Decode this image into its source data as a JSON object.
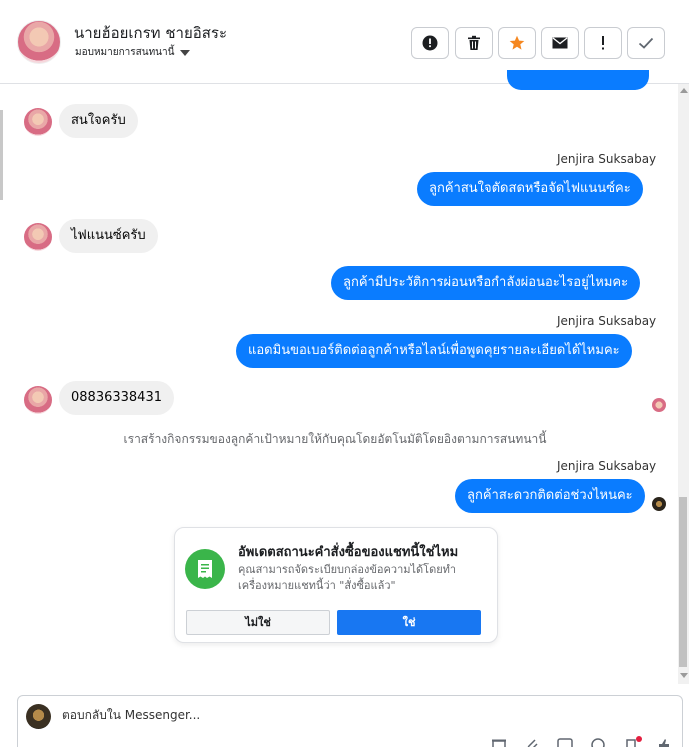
{
  "header": {
    "contact_name": "นายฮ้อยเกรท ชายอิสระ",
    "assign_label": "มอบหมายการสนทนานี้"
  },
  "messages": [
    {
      "direction": "in",
      "text": "สนใจครับ"
    },
    {
      "direction": "out",
      "sender": "Jenjira Suksabay",
      "text": "ลูกค้าสนใจตัดสดหรือจัดไฟแนนซ์คะ"
    },
    {
      "direction": "in",
      "text": "ไฟแนนซ์ครับ"
    },
    {
      "direction": "out",
      "text": "ลูกค้ามีประวัติการผ่อนหรือกำลังผ่อนอะไรอยู่ไหมคะ"
    },
    {
      "direction": "out",
      "sender": "Jenjira Suksabay",
      "text": "แอดมินขอเบอร์ติดต่อลูกค้าหรือไลน์เพื่อพูดคุยรายละเอียดได้ไหมคะ"
    },
    {
      "direction": "in",
      "text": "08836338431"
    },
    {
      "direction": "out",
      "sender": "Jenjira Suksabay",
      "text": "ลูกค้าสะดวกติดต่อช่วงไหนคะ"
    }
  ],
  "system_note": "เราสร้างกิจกรรมของลูกค้าเป้าหมายให้กับคุณโดยอัตโนมัติโดยอิงตามการสนทนานี้",
  "card": {
    "title": "อัพเดตสถานะคำสั่งซื้อของแชทนี้ใช่ไหม",
    "description": "คุณสามารถจัดระเบียบกล่องข้อความได้โดยทำเครื่องหมายแชทนี้ว่า \"สั่งซื้อแล้ว\"",
    "no_label": "ไม่ใช่",
    "yes_label": "ใช่"
  },
  "composer": {
    "placeholder": "ตอบกลับใน Messenger..."
  },
  "colors": {
    "outgoing_bubble": "#0a7cff",
    "incoming_bubble": "#f0f0f0",
    "card_icon": "#3ab54a",
    "primary_button": "#1877f2",
    "star_icon": "#f5871f"
  },
  "icons": [
    "alert-circle-icon",
    "trash-icon",
    "star-icon",
    "envelope-icon",
    "exclamation-icon",
    "check-icon",
    "receipt-icon"
  ]
}
